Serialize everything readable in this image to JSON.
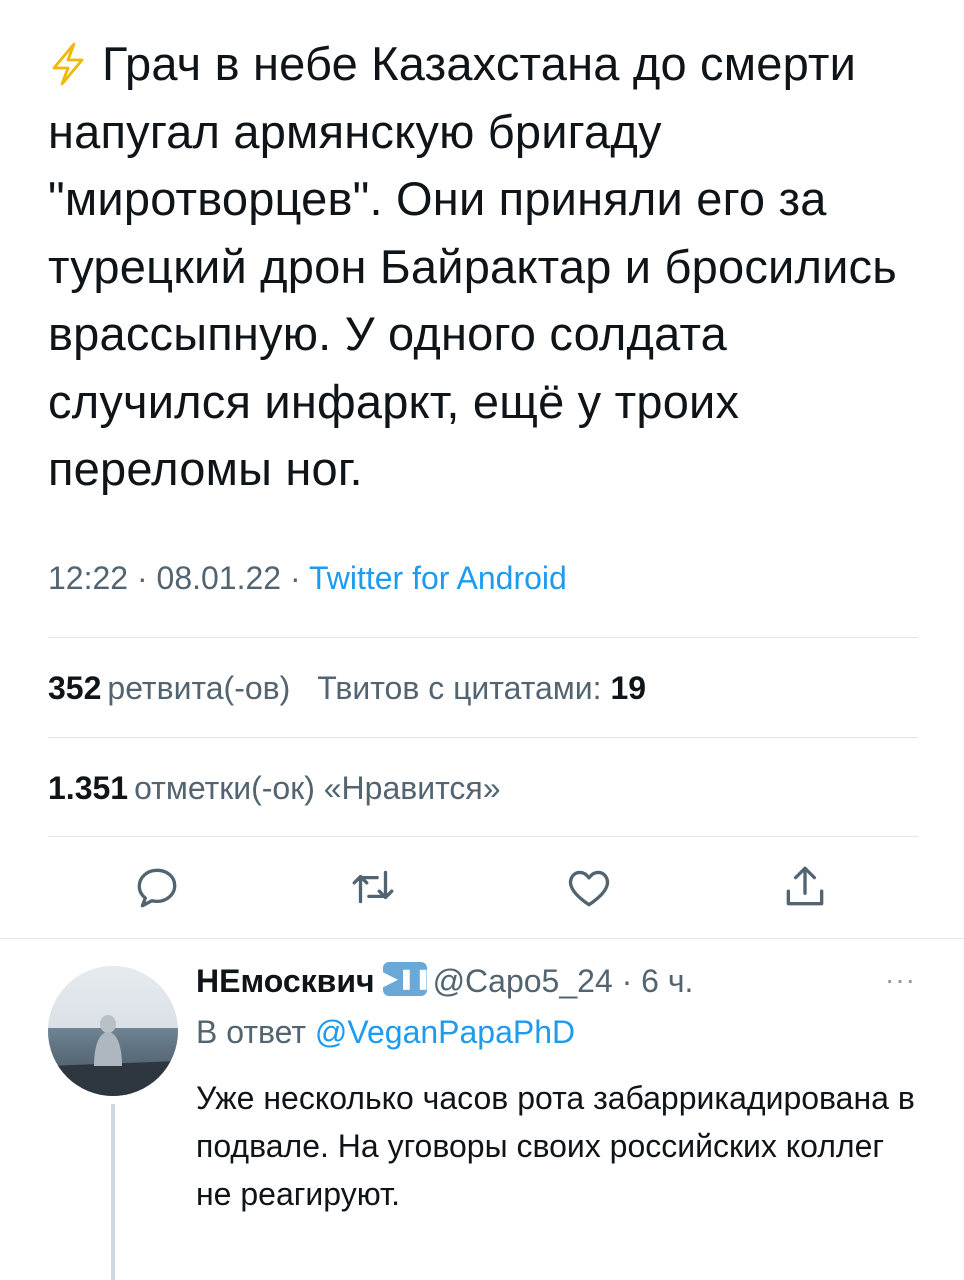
{
  "tweet": {
    "bolt_icon": "lightning-bolt",
    "text": "Грач в небе Казахстана до смерти напугал армянскую бригаду \"миротворцев\". Они приняли его за турецкий дрон Байрактар и бросились врассыпную. У одного солдата случился инфаркт, ещё у троих переломы ног.",
    "time": "12:22",
    "date": "08.01.22",
    "source": "Twitter for Android",
    "sep": "·"
  },
  "stats": {
    "retweets_count": "352",
    "retweets_label": "ретвита(-ов)",
    "quotes_label": "Твитов с цитатами:",
    "quotes_count": "19",
    "likes_count": "1.351",
    "likes_label": "отметки(-ок) «Нравится»"
  },
  "actions": [
    "reply-icon",
    "retweet-icon",
    "like-icon",
    "share-icon"
  ],
  "reply": {
    "name": "НЕмосквич",
    "badge_icon": "play-pause-emoji",
    "handle": "@Capo5_24",
    "time": "6 ч.",
    "more_label": "···",
    "reply_to_label": "В ответ",
    "reply_to_handle": "@VeganPapaPhD",
    "text": "Уже несколько часов рота забаррикадирована в подвале. На уговоры своих российских коллег не реагируют."
  },
  "colors": {
    "accent": "#1d9bf0",
    "muted": "#536471",
    "text": "#0f1419",
    "bolt": "#f5c518"
  }
}
